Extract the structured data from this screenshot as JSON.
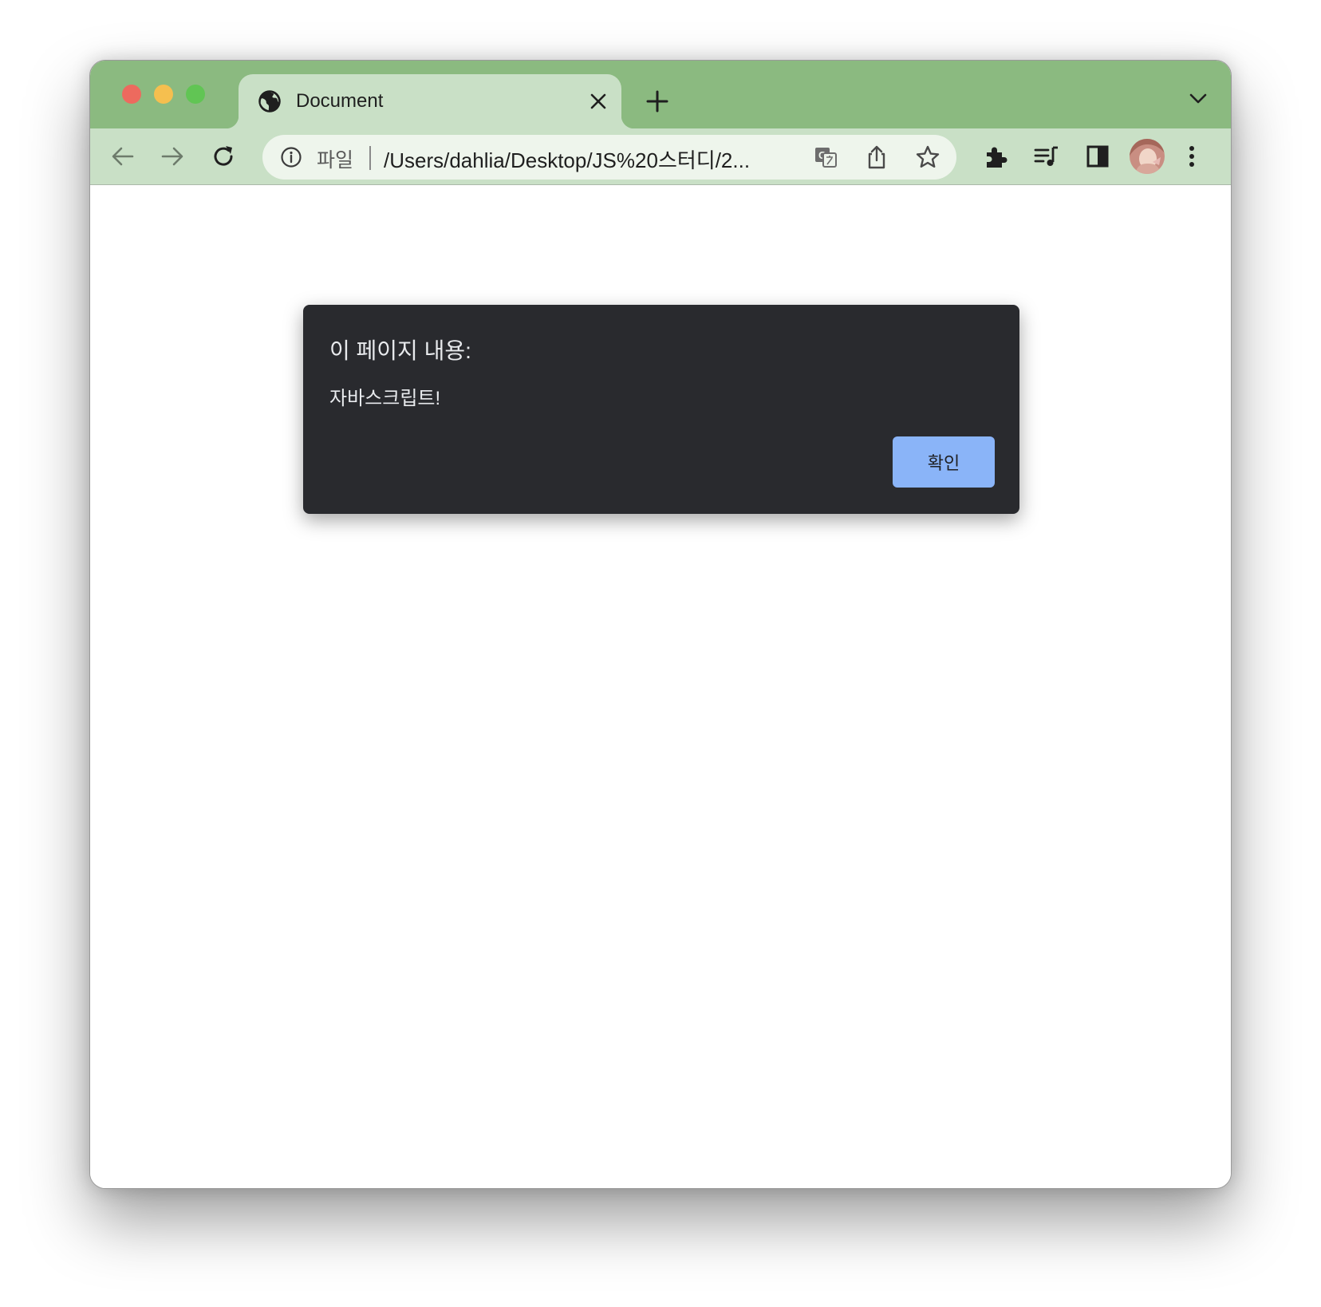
{
  "window": {
    "controls": [
      "close-icon",
      "minimize-icon",
      "zoom-icon"
    ]
  },
  "tab": {
    "title": "Document",
    "favicon": "globe-icon"
  },
  "toolbar": {
    "omnibox": {
      "scheme_label": "파일",
      "url": "/Users/dahlia/Desktop/JS%20스터디/2..."
    }
  },
  "dialog": {
    "title": "이 페이지 내용:",
    "message": "자바스크립트!",
    "ok_label": "확인",
    "ok_color": "#8ab4f8",
    "background": "#292a2e"
  },
  "colors": {
    "titlebar": "#8bba80",
    "toolbar": "#c9e0c6"
  }
}
